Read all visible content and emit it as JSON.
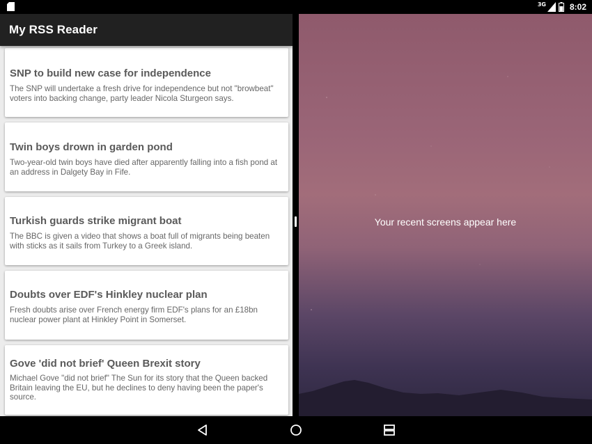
{
  "status_bar": {
    "network_label": "3G",
    "time": "8:02",
    "icons": [
      "sd-card-icon",
      "signal-icon",
      "battery-icon"
    ]
  },
  "app": {
    "title": "My RSS Reader",
    "articles": [
      {
        "title": "SNP to build new case for independence",
        "description": "The SNP will undertake a fresh drive for independence but not \"browbeat\" voters into backing change, party leader Nicola Sturgeon says."
      },
      {
        "title": "Twin boys drown in garden pond",
        "description": "Two-year-old twin boys have died after apparently falling into a fish pond at an address in Dalgety Bay in Fife."
      },
      {
        "title": "Turkish guards strike migrant boat",
        "description": "The BBC is given a video that shows a boat full of migrants being beaten with sticks as it sails from Turkey to a Greek island."
      },
      {
        "title": "Doubts over EDF's Hinkley nuclear plan",
        "description": "Fresh doubts arise over French energy firm EDF's plans for an £18bn nuclear power plant at Hinkley Point in Somerset."
      },
      {
        "title": "Gove 'did not brief' Queen Brexit story",
        "description": "Michael Gove \"did not brief\" The Sun for its story that the Queen backed Britain leaving the EU, but he declines to deny having been the paper's source."
      }
    ]
  },
  "recents": {
    "message": "Your recent screens appear here"
  },
  "nav_bar": {
    "buttons": [
      "back-icon",
      "home-icon",
      "recents-icon"
    ]
  },
  "colors": {
    "toolbar": "#212121",
    "card_title": "#5a5a5a",
    "card_text": "#666666",
    "feed_background": "#ececec"
  }
}
